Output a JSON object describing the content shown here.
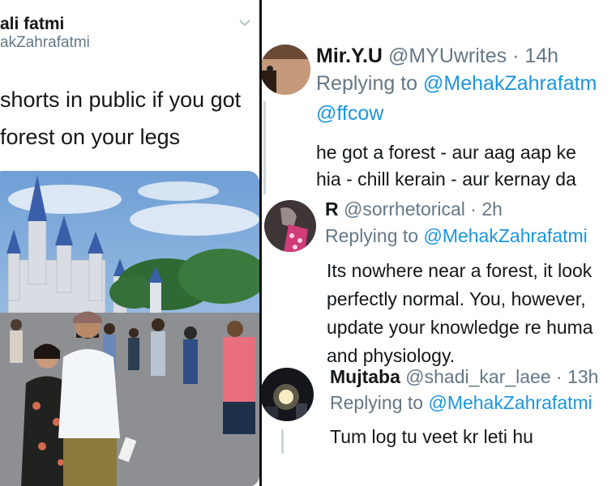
{
  "original_tweet": {
    "display_name": "ali fatmi",
    "handle": "akZahrafatmi",
    "text": "shorts in public if you got\nforest on your legs"
  },
  "replies": [
    {
      "name": "Mir.Y.U",
      "handle": "@MYUwrites",
      "sep": " · ",
      "time": "14h",
      "replying_prefix": "Replying to ",
      "replying_to": "@MehakZahrafatm",
      "mention2": "@ffcow",
      "body": [
        "he got a forest - aur aag aap ke",
        "hia - chill kerain - aur kernay da"
      ]
    },
    {
      "name": "R",
      "handle": "@sorrhetorical",
      "sep": " · ",
      "time": "2h",
      "replying_prefix": "Replying to ",
      "replying_to": "@MehakZahrafatmi",
      "body": [
        "Its nowhere near a forest, it look",
        "perfectly normal. You, however,",
        "update your knowledge re huma",
        "and physiology."
      ]
    },
    {
      "name": "Mujtaba",
      "handle": "@shadi_kar_laee",
      "sep": " · ",
      "time": "13h",
      "replying_prefix": "Replying to ",
      "replying_to": "@MehakZahrafatmi",
      "body": [
        "Tum log tu veet kr leti hu"
      ]
    }
  ],
  "icons": {
    "caret": "chevron-down-icon",
    "photo": "castle-photo"
  },
  "colors": {
    "link": "#1b95e0",
    "muted": "#657786",
    "text": "#14171a"
  }
}
